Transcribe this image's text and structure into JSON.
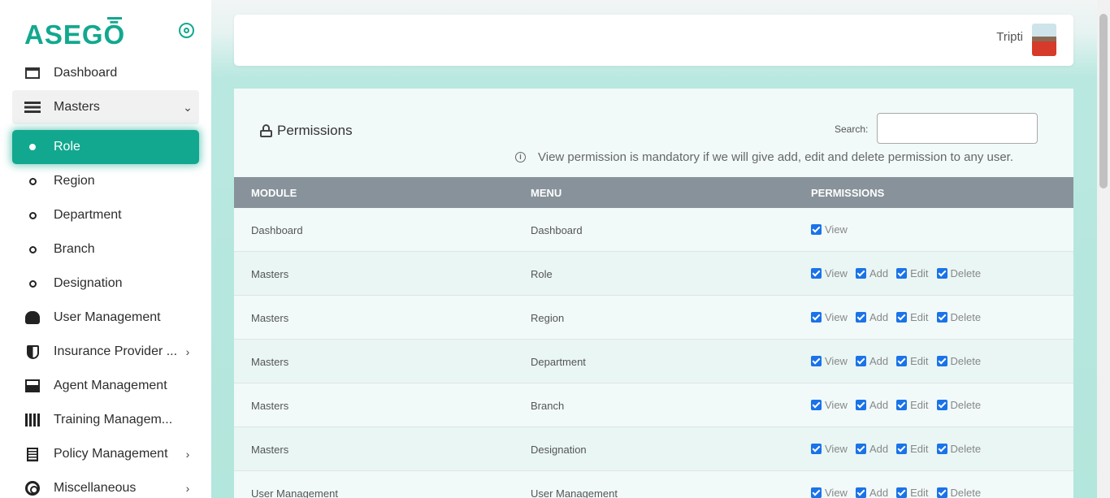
{
  "app": {
    "logo_main": "ASEG",
    "logo_accent": "Ō"
  },
  "sidebar": {
    "items": [
      {
        "label": "Dashboard"
      },
      {
        "label": "Masters"
      },
      {
        "label": "Role"
      },
      {
        "label": "Region"
      },
      {
        "label": "Department"
      },
      {
        "label": "Branch"
      },
      {
        "label": "Designation"
      },
      {
        "label": "User Management"
      },
      {
        "label": "Insurance Provider ..."
      },
      {
        "label": "Agent Management"
      },
      {
        "label": "Training Managem..."
      },
      {
        "label": "Policy Management"
      },
      {
        "label": "Miscellaneous"
      }
    ],
    "chevron_down": "⌄",
    "chevron_right": "›"
  },
  "header": {
    "user_name": "Tripti"
  },
  "permissions": {
    "title": "Permissions",
    "search_label": "Search:",
    "search_value": "",
    "info_icon_glyph": "i",
    "note": "View permission is mandatory if we will give add, edit and delete permission to any user.",
    "columns": [
      "MODULE",
      "MENU",
      "PERMISSIONS"
    ],
    "rows": [
      {
        "module": "Dashboard",
        "menu": "Dashboard",
        "perms": [
          "View"
        ]
      },
      {
        "module": "Masters",
        "menu": "Role",
        "perms": [
          "View",
          "Add",
          "Edit",
          "Delete"
        ]
      },
      {
        "module": "Masters",
        "menu": "Region",
        "perms": [
          "View",
          "Add",
          "Edit",
          "Delete"
        ]
      },
      {
        "module": "Masters",
        "menu": "Department",
        "perms": [
          "View",
          "Add",
          "Edit",
          "Delete"
        ]
      },
      {
        "module": "Masters",
        "menu": "Branch",
        "perms": [
          "View",
          "Add",
          "Edit",
          "Delete"
        ]
      },
      {
        "module": "Masters",
        "menu": "Designation",
        "perms": [
          "View",
          "Add",
          "Edit",
          "Delete"
        ]
      },
      {
        "module": "User Management",
        "menu": "User Management",
        "perms": [
          "View",
          "Add",
          "Edit",
          "Delete"
        ]
      }
    ]
  },
  "colors": {
    "brand": "#12a88f",
    "table_header": "#88929a",
    "checkbox": "#1a73e8"
  }
}
